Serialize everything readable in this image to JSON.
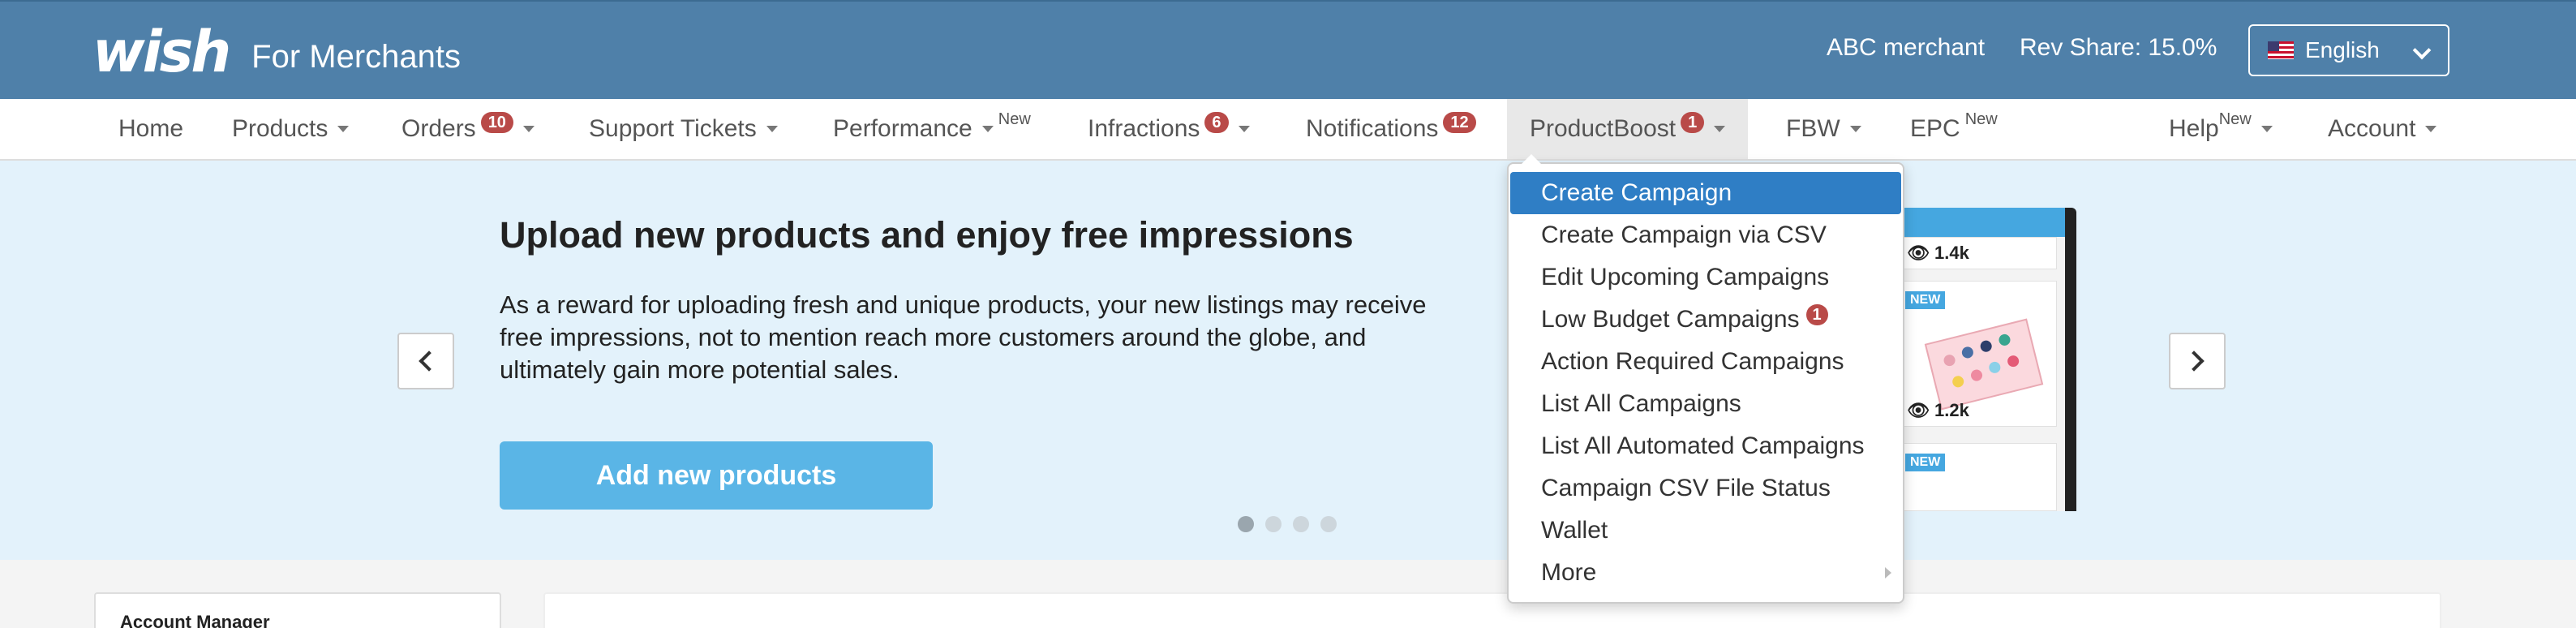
{
  "header": {
    "logo_word": "wish",
    "logo_sub": "For Merchants",
    "merchant_name": "ABC merchant",
    "rev_share": "Rev Share: 15.0%",
    "language": "English"
  },
  "nav": {
    "home": "Home",
    "products": "Products",
    "orders": "Orders",
    "orders_badge": "10",
    "support": "Support Tickets",
    "performance": "Performance",
    "performance_new": "New",
    "infractions": "Infractions",
    "infractions_badge": "6",
    "notifications": "Notifications",
    "notifications_badge": "12",
    "productboost": "ProductBoost",
    "productboost_badge": "1",
    "fbw": "FBW",
    "epc": "EPC",
    "epc_new": "New",
    "help": "Help",
    "help_new": "New",
    "account": "Account"
  },
  "banner": {
    "title": "Upload new products and enjoy free impressions",
    "body": "As a reward for uploading fresh and unique products, your new listings may receive free impressions, not to mention reach more customers around the globe, and ultimately gain more potential sales.",
    "cta": "Add new products",
    "slide_count": 4,
    "active_slide": 1,
    "phone": {
      "count_top": "1.4k",
      "count_mid": "1.2k",
      "new_tag": "NEW"
    }
  },
  "dropdown": {
    "items": [
      "Create Campaign",
      "Create Campaign via CSV",
      "Edit Upcoming Campaigns",
      "Low Budget Campaigns",
      "Action Required Campaigns",
      "List All Campaigns",
      "List All Automated Campaigns",
      "Campaign CSV File Status",
      "Wallet",
      "More"
    ],
    "low_budget_badge": "1"
  },
  "lower": {
    "account_manager": "Account Manager"
  },
  "colors": {
    "header_bg": "#4f80a9",
    "banner_bg": "#e3f2fb",
    "cta_bg": "#5ab5e6",
    "dropdown_active": "#2f7ec5",
    "badge": "#b94a48"
  }
}
